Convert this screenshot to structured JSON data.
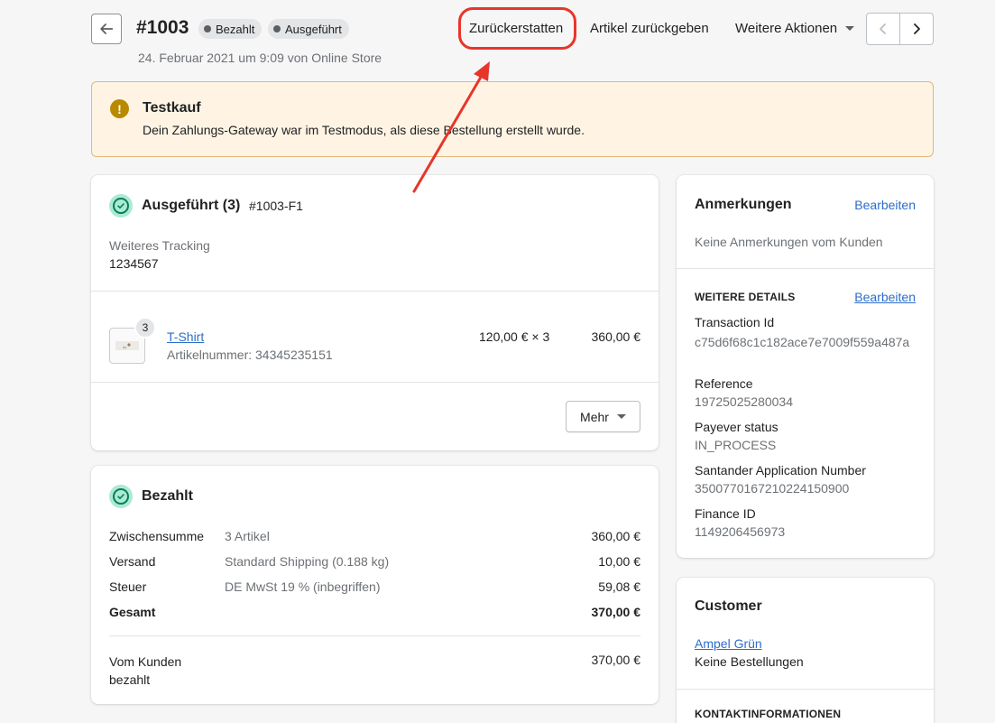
{
  "header": {
    "order_number": "#1003",
    "badges": [
      "Bezahlt",
      "Ausgeführt"
    ],
    "subtitle": "24. Februar 2021 um 9:09 von Online Store",
    "actions": {
      "refund": "Zurückerstatten",
      "return_items": "Artikel zurückgeben",
      "more_actions": "Weitere Aktionen"
    }
  },
  "banner": {
    "title": "Testkauf",
    "text": "Dein Zahlungs-Gateway war im Testmodus, als diese Bestellung erstellt wurde."
  },
  "fulfilled": {
    "title": "Ausgeführt (3)",
    "id": "#1003-F1",
    "tracking_label": "Weiteres Tracking",
    "tracking_number": "1234567",
    "item": {
      "quantity_badge": "3",
      "name": "T-Shirt",
      "sku": "Artikelnummer: 34345235151",
      "unit_price": "120,00 € × 3",
      "total": "360,00 €"
    },
    "more_button": "Mehr"
  },
  "paid": {
    "title": "Bezahlt",
    "rows": [
      {
        "label": "Zwischensumme",
        "desc": "3 Artikel",
        "amount": "360,00 €"
      },
      {
        "label": "Versand",
        "desc": "Standard Shipping (0.188 kg)",
        "amount": "10,00 €"
      },
      {
        "label": "Steuer",
        "desc": "DE MwSt 19 % (inbegriffen)",
        "amount": "59,08 €"
      },
      {
        "label": "Gesamt",
        "desc": "",
        "amount": "370,00 €"
      }
    ],
    "paid_by_customer_label": "Vom Kunden bezahlt",
    "paid_by_customer_amount": "370,00 €"
  },
  "notes": {
    "title": "Anmerkungen",
    "edit": "Bearbeiten",
    "empty": "Keine Anmerkungen vom Kunden",
    "details_title": "WEITERE DETAILS",
    "details_edit": "Bearbeiten",
    "details": [
      {
        "label": "Transaction Id",
        "value": "c75d6f68c1c182ace7e7009f559a487a"
      },
      {
        "label": "Reference",
        "value": "19725025280034"
      },
      {
        "label": "Payever status",
        "value": "IN_PROCESS"
      },
      {
        "label": "Santander Application Number",
        "value": "3500770167210224150900"
      },
      {
        "label": "Finance ID",
        "value": "1149206456973"
      }
    ]
  },
  "customer": {
    "title": "Customer",
    "name": "Ampel Grün",
    "orders": "Keine Bestellungen",
    "contact_title": "KONTAKTINFORMATIONEN"
  },
  "colors": {
    "highlight": "#e8352a",
    "banner_bg": "#fff4e4",
    "success": "#007f5f",
    "link": "#2c6ecb"
  }
}
